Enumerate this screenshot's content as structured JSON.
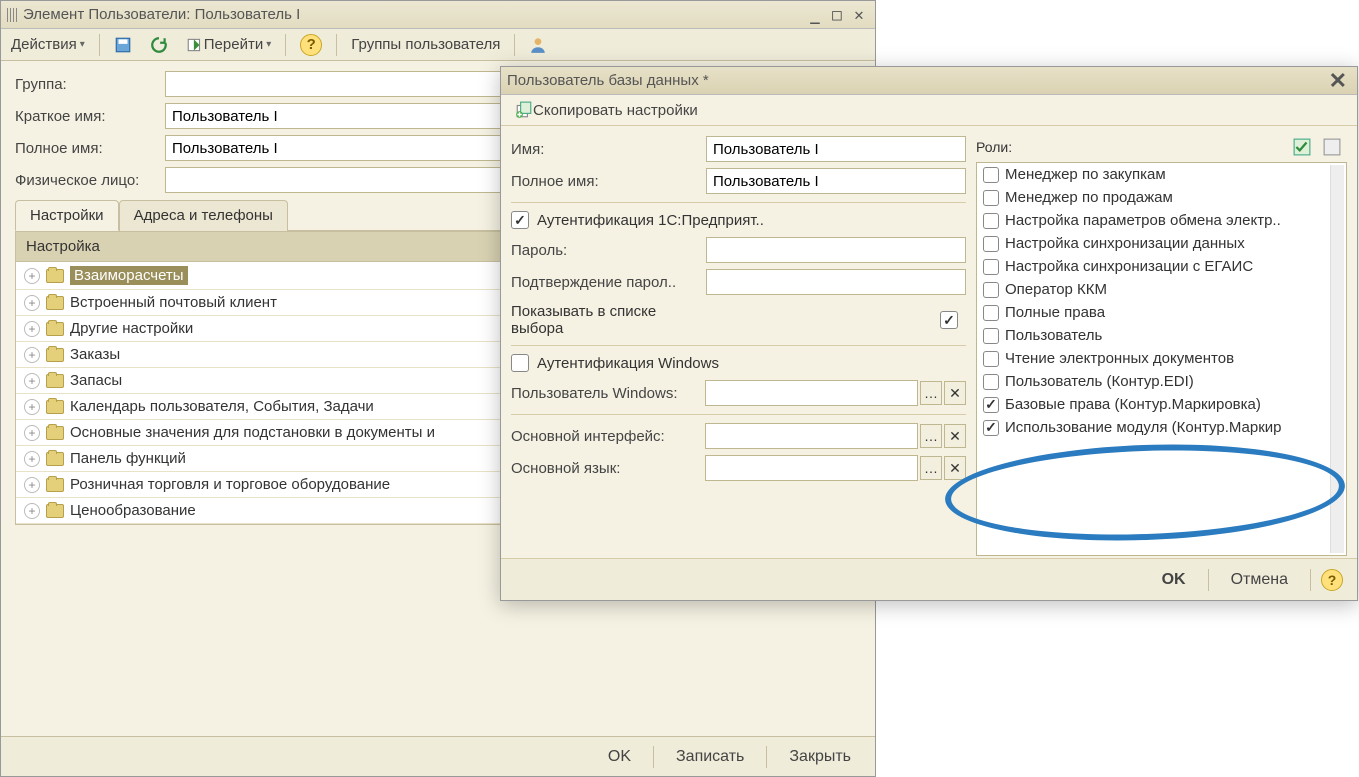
{
  "main": {
    "title": "Элемент Пользователи: Пользователь I",
    "toolbar": {
      "actions": "Действия",
      "goto": "Перейти",
      "user_groups": "Группы пользователя"
    },
    "form": {
      "group_label": "Группа:",
      "group_value": "",
      "short_name_label": "Краткое имя:",
      "short_name_value": "Пользователь I",
      "full_name_label": "Полное имя:",
      "full_name_value": "Пользователь I",
      "phys_label": "Физическое лицо:",
      "phys_value": ""
    },
    "tabs": [
      "Настройки",
      "Адреса и телефоны"
    ],
    "settings_header": "Настройка",
    "settings_items": [
      {
        "label": "Взаиморасчеты",
        "selected": true
      },
      {
        "label": "Встроенный почтовый клиент"
      },
      {
        "label": "Другие настройки"
      },
      {
        "label": "Заказы"
      },
      {
        "label": "Запасы"
      },
      {
        "label": "Календарь пользователя, События, Задачи"
      },
      {
        "label": "Основные значения для подстановки в документы и"
      },
      {
        "label": "Панель функций"
      },
      {
        "label": "Розничная торговля и торговое оборудование"
      },
      {
        "label": "Ценообразование"
      }
    ],
    "buttons": {
      "ok": "OK",
      "write": "Записать",
      "close": "Закрыть"
    }
  },
  "dbuser": {
    "title": "Пользователь базы данных *",
    "copy_settings": "Скопировать настройки",
    "name_label": "Имя:",
    "name_value": "Пользователь I",
    "full_name_label": "Полное имя:",
    "full_name_value": "Пользователь I",
    "auth1c_label": "Аутентификация 1С:Предприят..",
    "auth1c_checked": true,
    "password_label": "Пароль:",
    "password_value": "",
    "password_confirm_label": "Подтверждение парол..",
    "password_confirm_value": "",
    "show_in_list_label": "Показывать в списке выбора",
    "show_in_list_checked": true,
    "auth_win_label": "Аутентификация Windows",
    "auth_win_checked": false,
    "win_user_label": "Пользователь Windows:",
    "win_user_value": "",
    "main_iface_label": "Основной интерфейс:",
    "main_iface_value": "",
    "main_lang_label": "Основной язык:",
    "main_lang_value": "",
    "roles_label": "Роли:",
    "roles": [
      {
        "label": "Менеджер по закупкам",
        "checked": false
      },
      {
        "label": "Менеджер по продажам",
        "checked": false
      },
      {
        "label": "Настройка параметров обмена электр..",
        "checked": false
      },
      {
        "label": "Настройка синхронизации данных",
        "checked": false
      },
      {
        "label": "Настройка синхронизации с ЕГАИС",
        "checked": false
      },
      {
        "label": "Оператор ККМ",
        "checked": false
      },
      {
        "label": "Полные права",
        "checked": false
      },
      {
        "label": "Пользователь",
        "checked": false
      },
      {
        "label": "Чтение электронных документов",
        "checked": false
      },
      {
        "label": "Пользователь (Контур.EDI)",
        "checked": false
      },
      {
        "label": "Базовые права (Контур.Маркировка)",
        "checked": true
      },
      {
        "label": "Использование модуля (Контур.Маркир",
        "checked": true
      }
    ],
    "buttons": {
      "ok": "OK",
      "cancel": "Отмена"
    }
  }
}
